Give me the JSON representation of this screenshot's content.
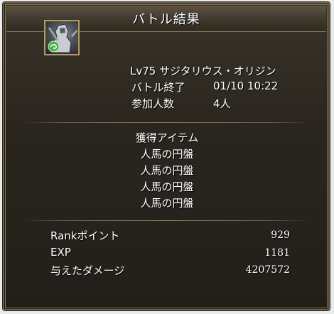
{
  "header": {
    "title": "バトル結果"
  },
  "battle": {
    "boss_name": "Lv75 サジタリウス・オリジン",
    "end_label": "バトル終了",
    "end_time": "01/10 10:22",
    "participants_label": "参加人数",
    "participants_value": "4人"
  },
  "items": {
    "heading": "獲得アイテム",
    "list": [
      "人馬の円盤",
      "人馬の円盤",
      "人馬の円盤",
      "人馬の円盤"
    ]
  },
  "stats": [
    {
      "label": "Rankポイント",
      "value": "929"
    },
    {
      "label": "EXP",
      "value": "1181"
    },
    {
      "label": "与えたダメージ",
      "value": "4207572"
    }
  ],
  "colors": {
    "frame": "#8b7a55",
    "background": "#25211b",
    "text": "#ffffff",
    "element_badge": "#4caf50"
  },
  "icons": {
    "element": "wind-element-icon"
  }
}
